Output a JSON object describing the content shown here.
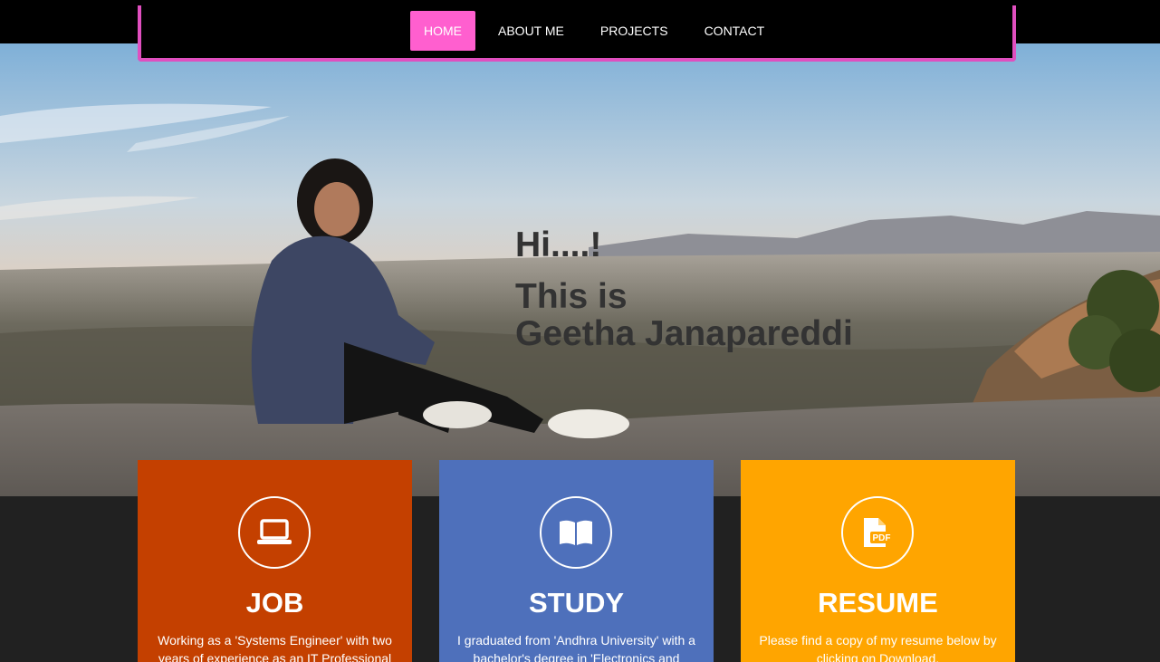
{
  "nav": {
    "items": [
      {
        "label": "HOME",
        "active": true
      },
      {
        "label": "ABOUT ME",
        "active": false
      },
      {
        "label": "PROJECTS",
        "active": false
      },
      {
        "label": "CONTACT",
        "active": false
      }
    ],
    "accent_color": "#e04fbf",
    "active_color": "#ff5fcf"
  },
  "hero": {
    "greeting": "Hi....!",
    "line2": "This is",
    "name": "Geetha Janapareddi"
  },
  "cards": [
    {
      "icon": "laptop-icon",
      "title": "JOB",
      "text": "Working as a 'Systems Engineer' with two years of experience as an IT Professional",
      "color": "#c44000"
    },
    {
      "icon": "open-book-icon",
      "title": "STUDY",
      "text": "I graduated from 'Andhra University' with a bachelor's degree in 'Electronics and",
      "color": "#4e70bb"
    },
    {
      "icon": "pdf-file-icon",
      "title": "RESUME",
      "text": "Please find a copy of my resume below by clicking on Download.",
      "color": "#ffa500"
    }
  ]
}
